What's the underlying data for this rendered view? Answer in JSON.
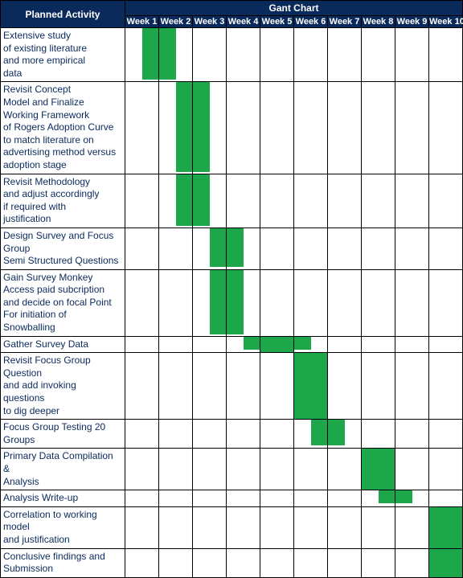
{
  "chart_data": {
    "type": "table",
    "title": "Gant Chart",
    "activity_header": "Planned Activity",
    "weeks": [
      "Week 1",
      "Week 2",
      "Week 3",
      "Week 4",
      "Week 5",
      "Week 6",
      "Week 7",
      "Week 8",
      "Week 9",
      "Week 10"
    ],
    "rows": [
      {
        "activity": "Extensive study\nof existing literature\nand more empirical\ndata",
        "bars": [
          [
            0.5,
            1.5
          ]
        ]
      },
      {
        "activity": "Revisit Concept\nModel and Finalize\nWorking Framework\nof Rogers Adoption Curve\nto match literature on\nadvertising method versus\nadoption stage",
        "bars": [
          [
            1.5,
            2.5
          ]
        ]
      },
      {
        "activity": "Revisit Methodology\nand adjust accordingly\nif required with\njustification",
        "bars": [
          [
            1.5,
            2.5
          ]
        ]
      },
      {
        "activity": "Design Survey and Focus\nGroup\nSemi Structured Questions",
        "bars": [
          [
            2.5,
            3.5
          ]
        ]
      },
      {
        "activity": "Gain Survey Monkey\nAccess paid subcription\nand decide on focal Point\nFor initiation of\nSnowballing",
        "bars": [
          [
            2.5,
            3.5
          ]
        ]
      },
      {
        "activity": "Gather Survey Data",
        "bars": [
          [
            3.5,
            5.5
          ]
        ]
      },
      {
        "activity": "Revisit Focus Group\nQuestion\nand add invoking\nquestions\nto dig deeper",
        "bars": [
          [
            5,
            6
          ]
        ]
      },
      {
        "activity": "Focus Group Testing 20\nGroups",
        "bars": [
          [
            5.5,
            6.5
          ]
        ]
      },
      {
        "activity": "Primary Data Compilation\n&\nAnalysis",
        "bars": [
          [
            7,
            8
          ]
        ]
      },
      {
        "activity": "Analysis Write-up",
        "bars": [
          [
            7.5,
            8.5
          ]
        ]
      },
      {
        "activity": "Correlation to working\nmodel\nand justification",
        "bars": [
          [
            9,
            10
          ]
        ]
      },
      {
        "activity": "Conclusive findings and\nSubmission",
        "bars": [
          [
            9,
            10
          ]
        ]
      }
    ]
  }
}
